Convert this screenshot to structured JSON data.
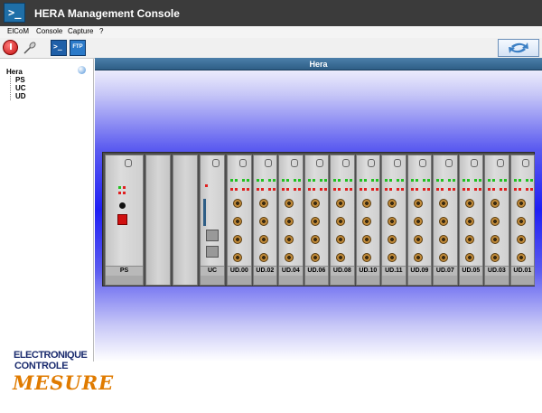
{
  "window": {
    "title": "HERA Management Console"
  },
  "menu": [
    "ElCoM",
    "Console",
    "Capture",
    "?"
  ],
  "toolbar": {
    "power": "power-icon",
    "probe": "probe-icon",
    "console": "console-icon",
    "ftp_label": "FTP",
    "refresh": "refresh-icon"
  },
  "tree": {
    "root": "Hera",
    "children": [
      "PS",
      "UC",
      "UD"
    ]
  },
  "panel": {
    "title": "Hera"
  },
  "rack": {
    "ps_label": "PS",
    "uc_label": "UC",
    "ud_labels": [
      "UD.00",
      "UD.02",
      "UD.04",
      "UD.06",
      "UD.08",
      "UD.10",
      "UD.11",
      "UD.09",
      "UD.07",
      "UD.05",
      "UD.03",
      "UD.01"
    ]
  },
  "logo": {
    "line1": "ELECTRONIQUE",
    "line2": "CONTROLE",
    "line3": "MESURE"
  },
  "colors": {
    "accent": "#2e5e86",
    "rack_bg": "#4d4d4d",
    "led_green": "#22c022",
    "led_red": "#e02020"
  }
}
